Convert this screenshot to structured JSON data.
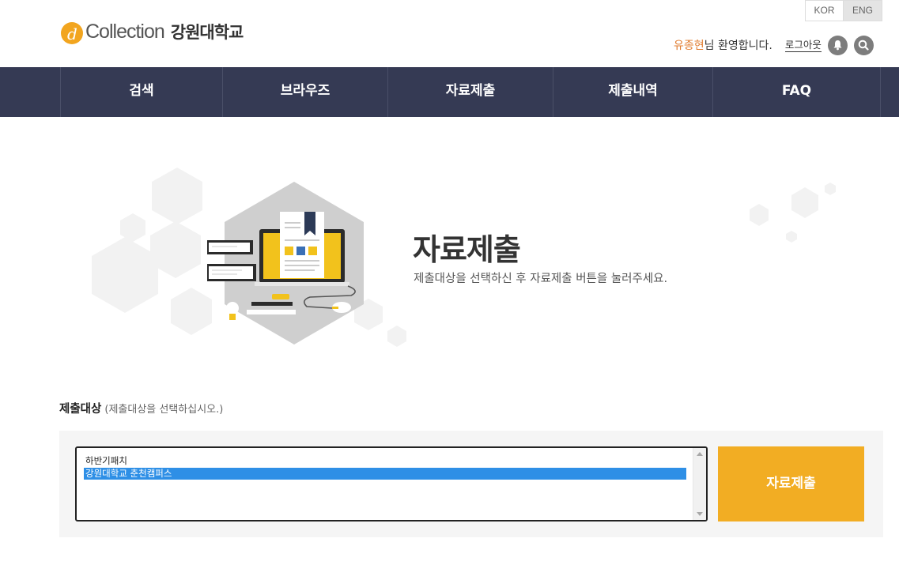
{
  "header": {
    "logo_text": "Collection",
    "university": "강원대학교",
    "lang": [
      "KOR",
      "ENG"
    ],
    "user_name": "유종현",
    "welcome": "님 환영합니다.",
    "logout": "로그아웃",
    "icons": [
      "bell-icon",
      "search-icon"
    ]
  },
  "nav": {
    "items": [
      {
        "label": "검색"
      },
      {
        "label": "브라우즈"
      },
      {
        "label": "자료제출"
      },
      {
        "label": "제출내역"
      },
      {
        "label": "FAQ"
      }
    ]
  },
  "hero": {
    "title": "자료제출",
    "subtitle": "제출대상을 선택하신 후 자료제출 버튼을 눌러주세요."
  },
  "target": {
    "label": "제출대상",
    "hint": "(제출대상을 선택하십시오.)",
    "options": [
      {
        "label": "하반기패치",
        "selected": false
      },
      {
        "label": "강원대학교 춘천캠퍼스",
        "selected": true
      }
    ],
    "submit_label": "자료제출"
  },
  "colors": {
    "nav_bg": "#353a54",
    "accent": "#f2ad23",
    "user_name": "#e07b2e",
    "selection": "#2e8fe6"
  }
}
